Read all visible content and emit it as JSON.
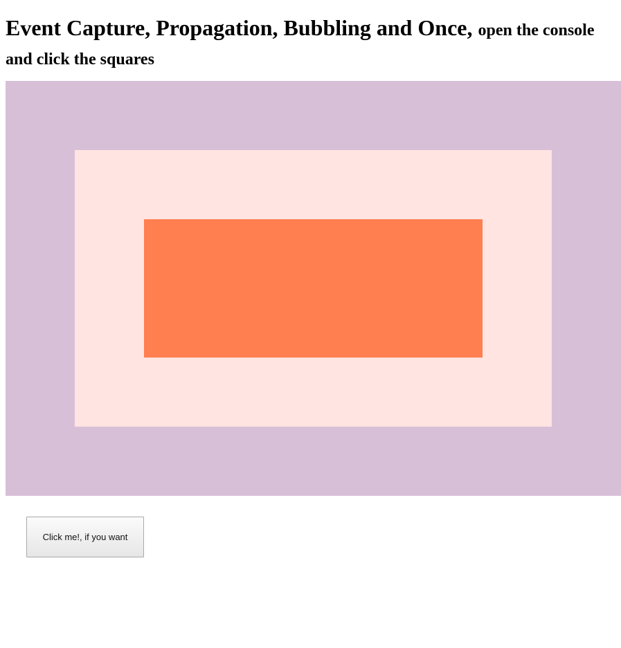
{
  "heading": {
    "main": "Event Capture, Propagation, Bubbling and Once,",
    "sub": "open the console and click the squares"
  },
  "squares": {
    "outer_color": "#d8bfd8",
    "middle_color": "#ffe4e1",
    "inner_color": "#ff7f50"
  },
  "button": {
    "label": "Click me!, if you want"
  }
}
